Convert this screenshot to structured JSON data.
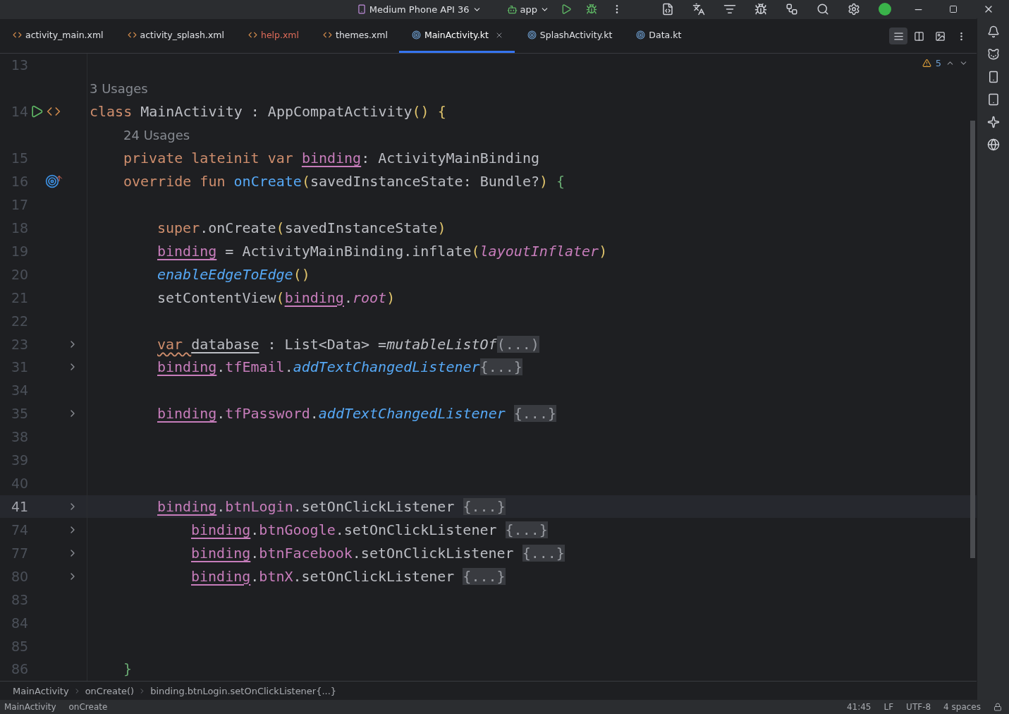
{
  "toolbar": {
    "device": "Medium Phone API 36",
    "run_config": "app"
  },
  "tabs": [
    {
      "label": "activity_main.xml",
      "kind": "xml",
      "error": false,
      "selected": false
    },
    {
      "label": "activity_splash.xml",
      "kind": "xml",
      "error": false,
      "selected": false
    },
    {
      "label": "help.xml",
      "kind": "xml",
      "error": true,
      "selected": false
    },
    {
      "label": "themes.xml",
      "kind": "xml",
      "error": false,
      "selected": false
    },
    {
      "label": "MainActivity.kt",
      "kind": "kotlin",
      "error": false,
      "selected": true
    },
    {
      "label": "SplashActivity.kt",
      "kind": "kotlin",
      "error": false,
      "selected": false
    },
    {
      "label": "Data.kt",
      "kind": "kotlin",
      "error": false,
      "selected": false
    }
  ],
  "inspections": {
    "warnings": "5"
  },
  "editor": {
    "lines": [
      {
        "kind": "code",
        "number": "13"
      },
      {
        "kind": "usages",
        "text": "3 Usages"
      },
      {
        "kind": "code",
        "number": "14",
        "runnable": true,
        "tokens": [
          {
            "text": "class ",
            "kind": "keyword"
          },
          {
            "text": "MainActivity : AppCompatActivity",
            "kind": "plain"
          },
          {
            "text": "()",
            "kind": "paren"
          },
          {
            "text": " {",
            "kind": "paren"
          }
        ],
        "children": [
          {
            "kind": "usages",
            "text": "24 Usages"
          },
          {
            "kind": "code",
            "number": "15",
            "tokens": [
              {
                "text": "private lateinit var ",
                "kind": "keyword"
              },
              {
                "text": "binding",
                "kind": "reference"
              },
              {
                "text": ": ActivityMainBinding",
                "kind": "plain"
              }
            ]
          },
          {
            "kind": "code",
            "number": "16",
            "overrides": true,
            "tokens": [
              {
                "text": "override fun ",
                "kind": "keyword"
              },
              {
                "text": "onCreate",
                "kind": "function"
              },
              {
                "text": "(",
                "kind": "paren"
              },
              {
                "text": "savedInstanceState: Bundle?",
                "kind": "plain"
              },
              {
                "text": ")",
                "kind": "paren"
              },
              {
                "text": " {",
                "kind": "brace"
              }
            ],
            "children": [
              {
                "kind": "code",
                "number": "17"
              },
              {
                "kind": "code",
                "number": "18",
                "tokens": [
                  {
                    "text": "super",
                    "kind": "keyword"
                  },
                  {
                    "text": ".onCreate",
                    "kind": "plain"
                  },
                  {
                    "text": "(",
                    "kind": "paren"
                  },
                  {
                    "text": "savedInstanceState",
                    "kind": "plain"
                  },
                  {
                    "text": ")",
                    "kind": "paren"
                  }
                ]
              },
              {
                "kind": "code",
                "number": "19",
                "tokens": [
                  {
                    "text": "binding",
                    "kind": "reference"
                  },
                  {
                    "text": " = ActivityMainBinding.inflate",
                    "kind": "plain"
                  },
                  {
                    "text": "(",
                    "kind": "paren"
                  },
                  {
                    "text": "layoutInflater",
                    "kind": "property-italic"
                  },
                  {
                    "text": ")",
                    "kind": "paren"
                  }
                ]
              },
              {
                "kind": "code",
                "number": "20",
                "tokens": [
                  {
                    "text": "enableEdgeToEdge",
                    "kind": "function-italic"
                  },
                  {
                    "text": "()",
                    "kind": "paren"
                  }
                ]
              },
              {
                "kind": "code",
                "number": "21",
                "tokens": [
                  {
                    "text": "setContentView",
                    "kind": "plain"
                  },
                  {
                    "text": "(",
                    "kind": "paren"
                  },
                  {
                    "text": "binding",
                    "kind": "reference"
                  },
                  {
                    "text": ".",
                    "kind": "plain"
                  },
                  {
                    "text": "root",
                    "kind": "property-italic"
                  },
                  {
                    "text": ")",
                    "kind": "paren"
                  }
                ]
              },
              {
                "kind": "code",
                "number": "22"
              },
              {
                "kind": "code",
                "number": "23",
                "fold": true,
                "tokens": [
                  {
                    "text": "var ",
                    "kind": "warning"
                  },
                  {
                    "text": "database",
                    "kind": "underlined"
                  },
                  {
                    "text": " : List<Data> =",
                    "kind": "plain"
                  },
                  {
                    "text": "mutableListOf",
                    "kind": "plain-italic"
                  },
                  {
                    "text": "(...)",
                    "kind": "folded"
                  }
                ]
              },
              {
                "kind": "code",
                "number": "31",
                "fold": true,
                "tokens": [
                  {
                    "text": "binding",
                    "kind": "reference"
                  },
                  {
                    "text": ".",
                    "kind": "plain"
                  },
                  {
                    "text": "tfEmail",
                    "kind": "property"
                  },
                  {
                    "text": ".",
                    "kind": "plain"
                  },
                  {
                    "text": "addTextChangedListener",
                    "kind": "function-italic"
                  },
                  {
                    "text": "{...}",
                    "kind": "folded"
                  }
                ]
              },
              {
                "kind": "code",
                "number": "34"
              },
              {
                "kind": "code",
                "number": "35",
                "fold": true,
                "tokens": [
                  {
                    "text": "binding",
                    "kind": "reference"
                  },
                  {
                    "text": ".",
                    "kind": "plain"
                  },
                  {
                    "text": "tfPassword",
                    "kind": "property"
                  },
                  {
                    "text": ".",
                    "kind": "plain"
                  },
                  {
                    "text": "addTextChangedListener ",
                    "kind": "function-italic"
                  },
                  {
                    "text": "{...}",
                    "kind": "folded"
                  }
                ]
              },
              {
                "kind": "code",
                "number": "38"
              },
              {
                "kind": "code",
                "number": "39"
              },
              {
                "kind": "code",
                "number": "40"
              },
              {
                "kind": "code",
                "number": "41",
                "fold": true,
                "current": true,
                "tokens": [
                  {
                    "text": "binding",
                    "kind": "reference"
                  },
                  {
                    "text": ".",
                    "kind": "plain"
                  },
                  {
                    "text": "btnLogin",
                    "kind": "property"
                  },
                  {
                    "text": ".setOnClickListener ",
                    "kind": "plain"
                  },
                  {
                    "text": "{...}",
                    "kind": "folded"
                  }
                ],
                "children": [
                  {
                    "kind": "code",
                    "number": "74",
                    "fold": true,
                    "tokens": [
                      {
                        "text": "binding",
                        "kind": "reference"
                      },
                      {
                        "text": ".",
                        "kind": "plain"
                      },
                      {
                        "text": "btnGoogle",
                        "kind": "property"
                      },
                      {
                        "text": ".setOnClickListener ",
                        "kind": "plain"
                      },
                      {
                        "text": "{...}",
                        "kind": "folded"
                      }
                    ]
                  },
                  {
                    "kind": "code",
                    "number": "77",
                    "fold": true,
                    "tokens": [
                      {
                        "text": "binding",
                        "kind": "reference"
                      },
                      {
                        "text": ".",
                        "kind": "plain"
                      },
                      {
                        "text": "btnFacebook",
                        "kind": "property"
                      },
                      {
                        "text": ".setOnClickListener ",
                        "kind": "plain"
                      },
                      {
                        "text": "{...}",
                        "kind": "folded"
                      }
                    ]
                  },
                  {
                    "kind": "code",
                    "number": "80",
                    "fold": true,
                    "tokens": [
                      {
                        "text": "binding",
                        "kind": "reference"
                      },
                      {
                        "text": ".",
                        "kind": "plain"
                      },
                      {
                        "text": "btnX",
                        "kind": "property"
                      },
                      {
                        "text": ".setOnClickListener ",
                        "kind": "plain"
                      },
                      {
                        "text": "{...}",
                        "kind": "folded"
                      }
                    ]
                  }
                ]
              },
              {
                "kind": "code",
                "number": "83"
              },
              {
                "kind": "code",
                "number": "84"
              },
              {
                "kind": "code",
                "number": "85"
              }
            ]
          },
          {
            "kind": "code",
            "number": "86",
            "tokens": [
              {
                "text": "}",
                "kind": "brace"
              }
            ]
          }
        ]
      }
    ]
  },
  "breadcrumbs": [
    "MainActivity",
    "onCreate()",
    "binding.btnLogin.setOnClickListener{...}"
  ],
  "status_bar": {
    "path": [
      "MainActivity",
      "onCreate"
    ],
    "position": "41:45",
    "line_separator": "LF",
    "encoding": "UTF-8",
    "indent": "4 spaces"
  }
}
